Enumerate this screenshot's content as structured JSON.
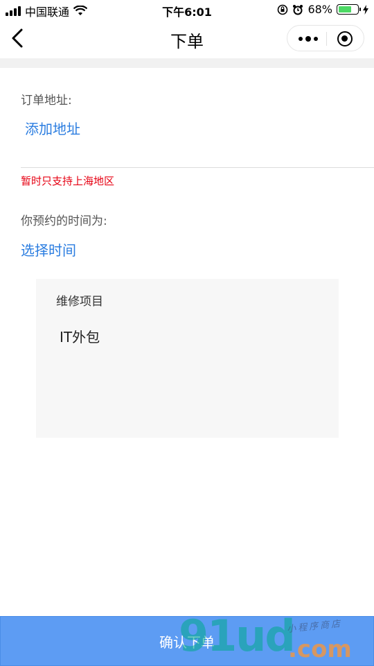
{
  "status_bar": {
    "carrier": "中国联通",
    "time": "下午6:01",
    "battery": "68%",
    "battery_level": 0.68,
    "icons": [
      "signal-icon",
      "wifi-icon",
      "rotation-lock-icon",
      "alarm-icon",
      "battery-icon",
      "charging-icon"
    ]
  },
  "nav": {
    "title": "下单",
    "back_icon": "chevron-left-icon",
    "more_icon": "more-dots-icon",
    "close_icon": "target-circle-icon"
  },
  "address": {
    "label": "订单地址:",
    "add_link": "添加地址",
    "notice": "暂时只支持上海地区"
  },
  "time": {
    "label": "你预约的时间为:",
    "select_link": "选择时间"
  },
  "repair": {
    "title": "维修项目",
    "item": "IT外包"
  },
  "submit": {
    "label": "确认下单"
  },
  "watermark": {
    "main": "91ud",
    "domain": ".com",
    "tagline": "小程序商店"
  },
  "colors": {
    "link": "#2b7de0",
    "notice": "#e60012",
    "button": "#5d9cf3"
  }
}
